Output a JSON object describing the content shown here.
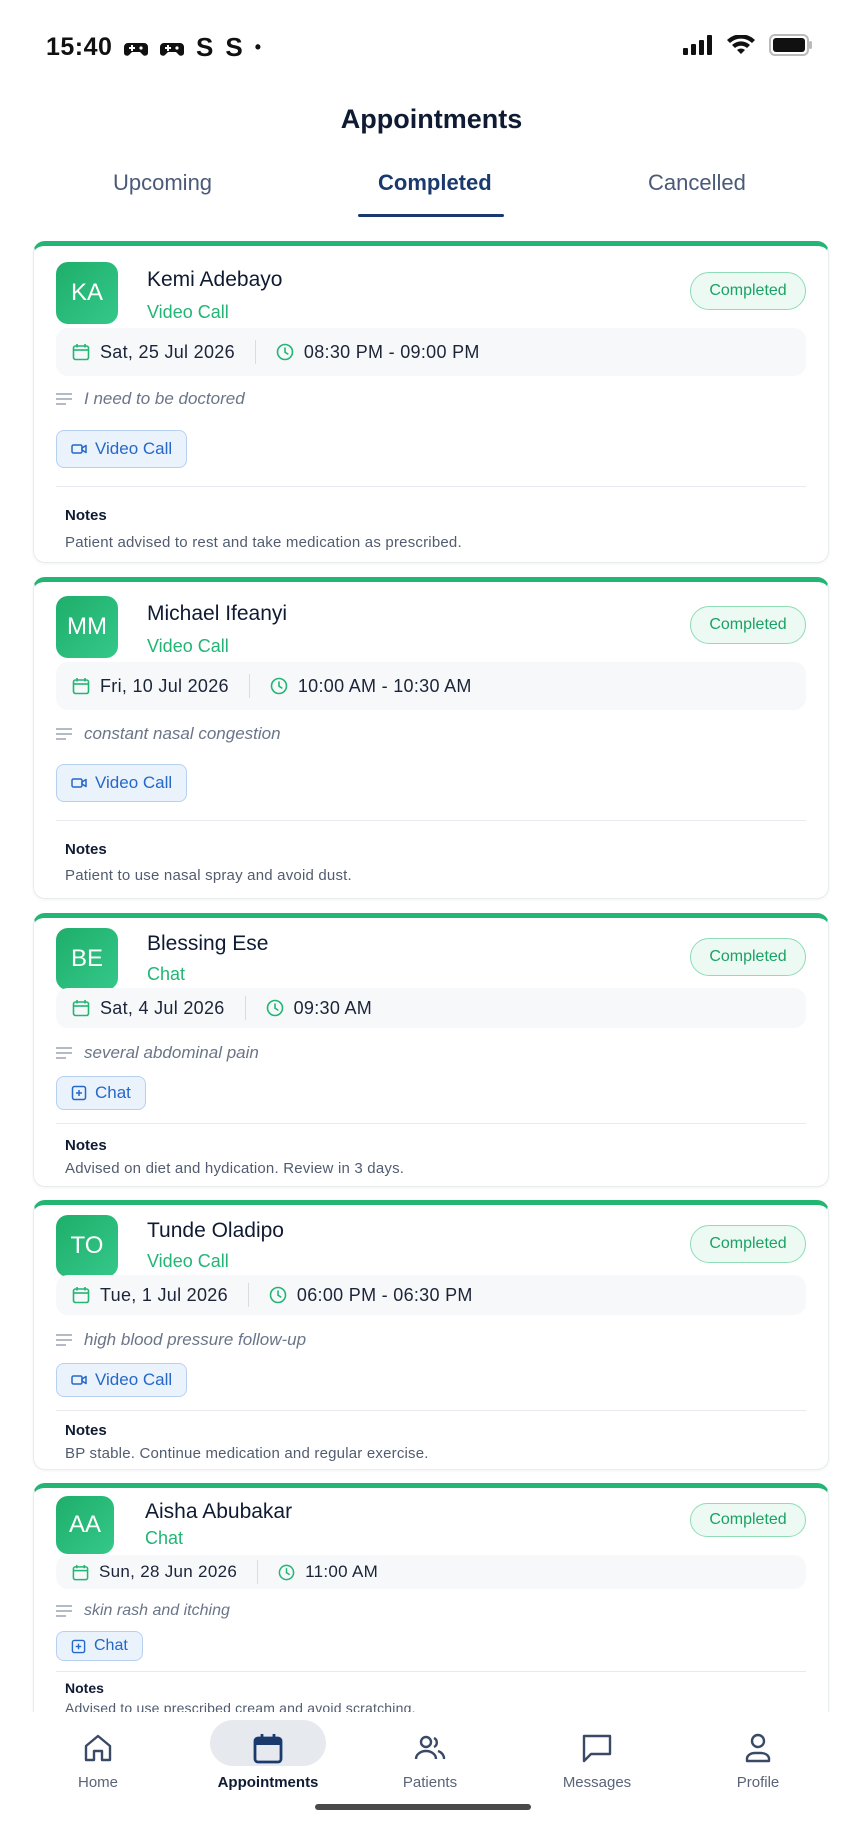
{
  "status_bar": {
    "time": "15:40",
    "left_glyphs": [
      "S",
      "S",
      "•"
    ]
  },
  "header": {
    "title": "Appointments"
  },
  "tabs": [
    {
      "label": "Upcoming"
    },
    {
      "label": "Completed"
    },
    {
      "label": "Cancelled"
    }
  ],
  "appointments": [
    {
      "initials": "KA",
      "name": "Kemi Adebayo",
      "type": "Video Call",
      "status": "Completed",
      "date": "Sat, 25 Jul 2026",
      "time": "08:30 PM - 09:00 PM",
      "reason": "I need to be doctored",
      "chip_label": "Video Call",
      "chip_icon": "video-icon",
      "notes_label": "Notes",
      "notes": "Patient advised to rest and take medication as prescribed."
    },
    {
      "initials": "MM",
      "name": "Michael Ifeanyi",
      "type": "Video Call",
      "status": "Completed",
      "date": "Fri, 10 Jul 2026",
      "time": "10:00 AM - 10:30 AM",
      "reason": "constant nasal congestion",
      "chip_label": "Video Call",
      "chip_icon": "video-icon",
      "notes_label": "Notes",
      "notes": "Patient to use nasal spray and avoid dust."
    },
    {
      "initials": "BE",
      "name": "Blessing Ese",
      "type": "Chat",
      "status": "Completed",
      "date": "Sat, 4 Jul 2026",
      "time": "09:30 AM",
      "reason": "several abdominal pain",
      "chip_label": "Chat",
      "chip_icon": "chat-icon",
      "notes_label": "Notes",
      "notes": "Advised on diet and hydication. Review in 3 days."
    },
    {
      "initials": "TO",
      "name": "Tunde Oladipo",
      "type": "Video Call",
      "status": "Completed",
      "date": "Tue, 1 Jul 2026",
      "time": "06:00 PM - 06:30 PM",
      "reason": "high blood pressure follow-up",
      "chip_label": "Video Call",
      "chip_icon": "video-icon",
      "notes_label": "Notes",
      "notes": "BP stable. Continue medication and regular exercise."
    },
    {
      "initials": "AA",
      "name": "Aisha Abubakar",
      "type": "Chat",
      "status": "Completed",
      "date": "Sun, 28 Jun 2026",
      "time": "11:00 AM",
      "reason": "skin rash and itching",
      "chip_label": "Chat",
      "chip_icon": "chat-icon",
      "notes_label": "Notes",
      "notes": "Advised to use prescribed cream and avoid scratching."
    }
  ],
  "bottom_nav": [
    {
      "label": "Home",
      "icon": "home-icon"
    },
    {
      "label": "Appointments",
      "icon": "calendar-icon"
    },
    {
      "label": "Patients",
      "icon": "people-icon"
    },
    {
      "label": "Messages",
      "icon": "message-icon"
    },
    {
      "label": "Profile",
      "icon": "person-icon"
    }
  ],
  "colors": {
    "accent_green": "#22b574",
    "navy": "#1a3a6e",
    "chip_blue": "#2568c9"
  }
}
